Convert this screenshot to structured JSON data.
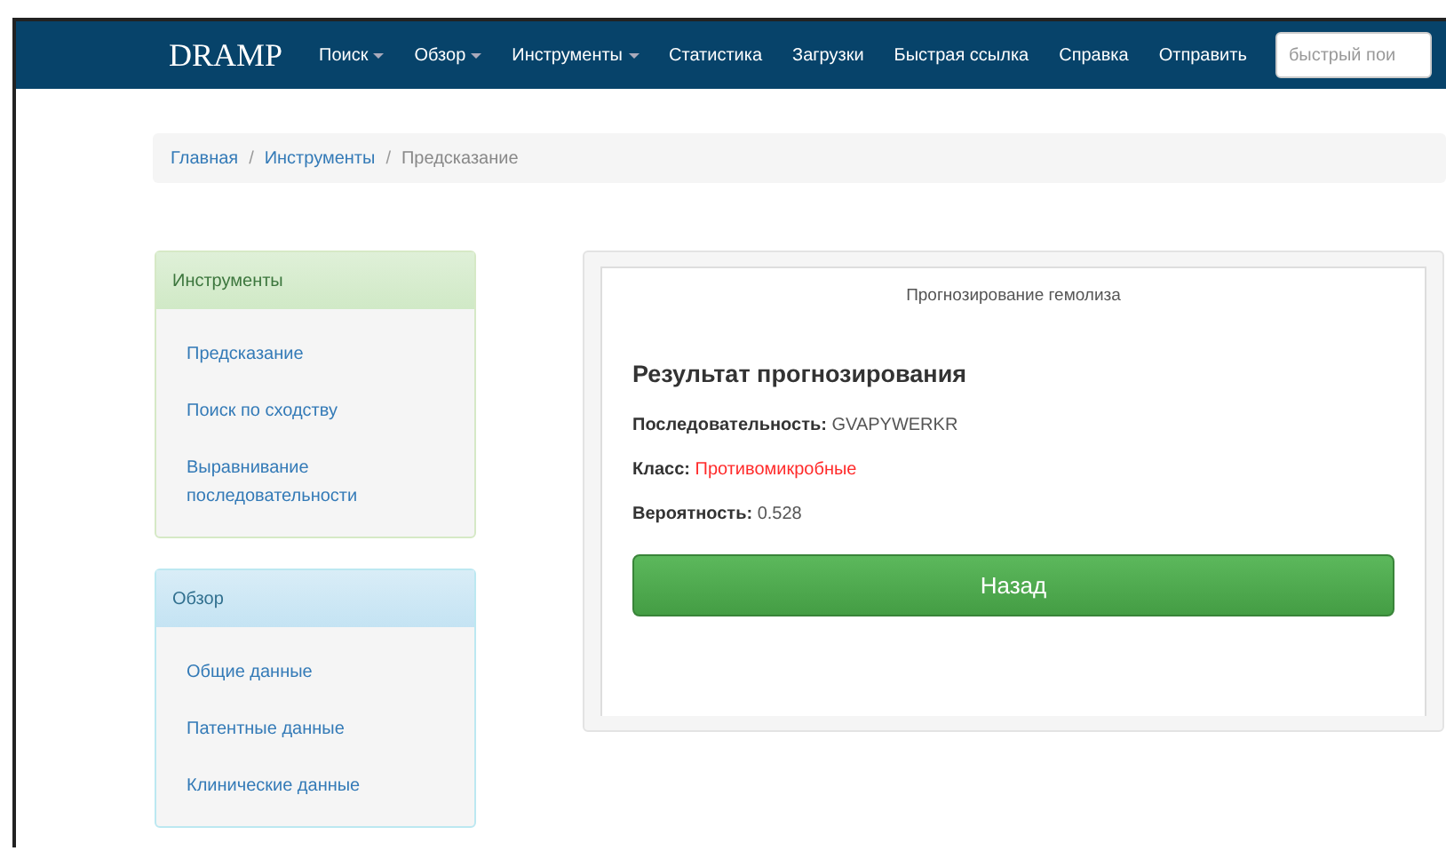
{
  "navbar": {
    "brand": "DRAMP",
    "items": [
      {
        "label": "Поиск",
        "dropdown": true
      },
      {
        "label": "Обзор",
        "dropdown": true
      },
      {
        "label": "Инструменты",
        "dropdown": true
      },
      {
        "label": "Статистика",
        "dropdown": false
      },
      {
        "label": "Загрузки",
        "dropdown": false
      },
      {
        "label": "Быстрая ссылка",
        "dropdown": false
      },
      {
        "label": "Справка",
        "dropdown": false
      },
      {
        "label": "Отправить",
        "dropdown": false
      }
    ],
    "search": {
      "placeholder": "быстрый пои"
    }
  },
  "breadcrumb_separator": "/",
  "breadcrumb": [
    {
      "label": "Главная",
      "link": true
    },
    {
      "label": "Инструменты",
      "link": true
    },
    {
      "label": "Предсказание",
      "link": false
    }
  ],
  "sidebar": [
    {
      "title": "Инструменты",
      "kind": "success",
      "items": [
        "Предсказание",
        "Поиск по сходству",
        "Выравнивание последовательности"
      ]
    },
    {
      "title": "Обзор",
      "kind": "info",
      "items": [
        "Общие данные",
        "Патентные данные",
        "Клинические данные"
      ]
    }
  ],
  "result": {
    "tab": "Прогнозирование гемолиза",
    "heading": "Результат прогнозирования",
    "fields": [
      {
        "label": "Последовательность:",
        "value": "GVAPYWERKR",
        "color": "#555555"
      },
      {
        "label": "Класс:",
        "value": "Противомикробные",
        "color": "#ff2a2a"
      },
      {
        "label": "Вероятность:",
        "value": "0.528",
        "color": "#555555"
      }
    ],
    "button": "Назад"
  }
}
